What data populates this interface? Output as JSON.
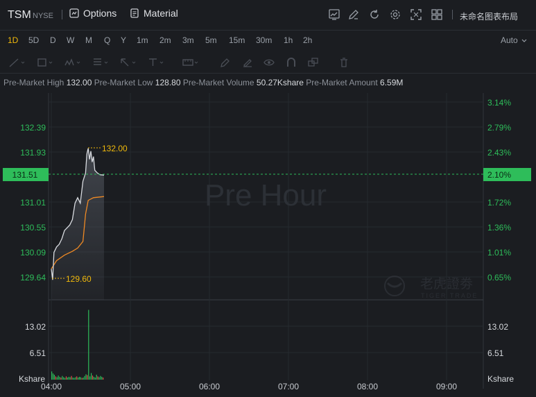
{
  "header": {
    "symbol": "TSM",
    "exchange": "NYSE",
    "options_label": "Options",
    "material_label": "Material",
    "layout_name": "未命名图表布局"
  },
  "timeframes": [
    "1D",
    "5D",
    "D",
    "W",
    "M",
    "Q",
    "Y",
    "1m",
    "2m",
    "3m",
    "5m",
    "15m",
    "30m",
    "1h",
    "2h"
  ],
  "active_timeframe": "1D",
  "auto_label": "Auto",
  "info": {
    "high_label": "Pre-Market High",
    "high_value": "132.00",
    "low_label": "Pre-Market Low",
    "low_value": "128.80",
    "volume_label": "Pre-Market Volume",
    "volume_value": "50.27Kshare",
    "amount_label": "Pre-Market Amount",
    "amount_value": "6.59M"
  },
  "watermark": "Pre Hour",
  "brand_text": "老虎證劵",
  "brand_sub": "TIGER TRADE",
  "chart_data": {
    "type": "line",
    "price_axis": [
      "132.39",
      "131.93",
      "131.01",
      "130.55",
      "130.09",
      "129.64"
    ],
    "current_price": "131.51",
    "current_percent": "2.10%",
    "percent_axis": [
      "3.14%",
      "2.79%",
      "2.43%",
      "1.72%",
      "1.36%",
      "1.01%",
      "0.65%"
    ],
    "high_marker": "132.00",
    "low_marker": "129.60",
    "volume_axis": [
      "13.02",
      "6.51"
    ],
    "volume_unit": "Kshare",
    "x_labels": [
      "04:00",
      "05:00",
      "06:00",
      "07:00",
      "08:00",
      "09:00"
    ],
    "price_series": [
      {
        "t": "04:00",
        "v": 129.8
      },
      {
        "t": "04:01",
        "v": 129.6
      },
      {
        "t": "04:02",
        "v": 130.1
      },
      {
        "t": "04:04",
        "v": 130.2
      },
      {
        "t": "04:06",
        "v": 130.25
      },
      {
        "t": "04:08",
        "v": 130.35
      },
      {
        "t": "04:10",
        "v": 130.5
      },
      {
        "t": "04:12",
        "v": 130.55
      },
      {
        "t": "04:14",
        "v": 130.6
      },
      {
        "t": "04:16",
        "v": 130.7
      },
      {
        "t": "04:18",
        "v": 131.0
      },
      {
        "t": "04:20",
        "v": 131.1
      },
      {
        "t": "04:22",
        "v": 131.0
      },
      {
        "t": "04:24",
        "v": 131.4
      },
      {
        "t": "04:26",
        "v": 131.55
      },
      {
        "t": "04:27",
        "v": 131.9
      },
      {
        "t": "04:28",
        "v": 132.0
      },
      {
        "t": "04:29",
        "v": 131.8
      },
      {
        "t": "04:30",
        "v": 131.95
      },
      {
        "t": "04:31",
        "v": 131.75
      },
      {
        "t": "04:32",
        "v": 131.85
      },
      {
        "t": "04:33",
        "v": 131.6
      },
      {
        "t": "04:35",
        "v": 131.55
      },
      {
        "t": "04:37",
        "v": 131.52
      },
      {
        "t": "04:40",
        "v": 131.51
      }
    ],
    "avg_series": [
      {
        "t": "04:00",
        "v": 129.8
      },
      {
        "t": "04:04",
        "v": 129.95
      },
      {
        "t": "04:10",
        "v": 130.05
      },
      {
        "t": "04:16",
        "v": 130.12
      },
      {
        "t": "04:20",
        "v": 130.18
      },
      {
        "t": "04:24",
        "v": 130.3
      },
      {
        "t": "04:26",
        "v": 130.8
      },
      {
        "t": "04:28",
        "v": 131.05
      },
      {
        "t": "04:32",
        "v": 131.1
      },
      {
        "t": "04:40",
        "v": 131.12
      }
    ],
    "volume": [
      2.0,
      1.5,
      1.2,
      0.8,
      0.6,
      1.0,
      0.7,
      0.5,
      0.9,
      0.6,
      0.4,
      0.8,
      0.5,
      0.7,
      0.6,
      0.9,
      0.5,
      0.4,
      0.6,
      0.8,
      0.5,
      0.7,
      0.6,
      0.4,
      0.5,
      0.9,
      1.3,
      1.1,
      17.0,
      0.8,
      1.6,
      1.0,
      0.7,
      0.5,
      1.2,
      0.8,
      0.6,
      0.9,
      0.7,
      0.5
    ]
  },
  "colors": {
    "price_line": "#d9dce1",
    "avg_line": "#f08a24",
    "up": "#2ebd5a",
    "down": "#e54d4d",
    "marker": "#f0b90b",
    "current_tag": "#2ebd5a"
  }
}
